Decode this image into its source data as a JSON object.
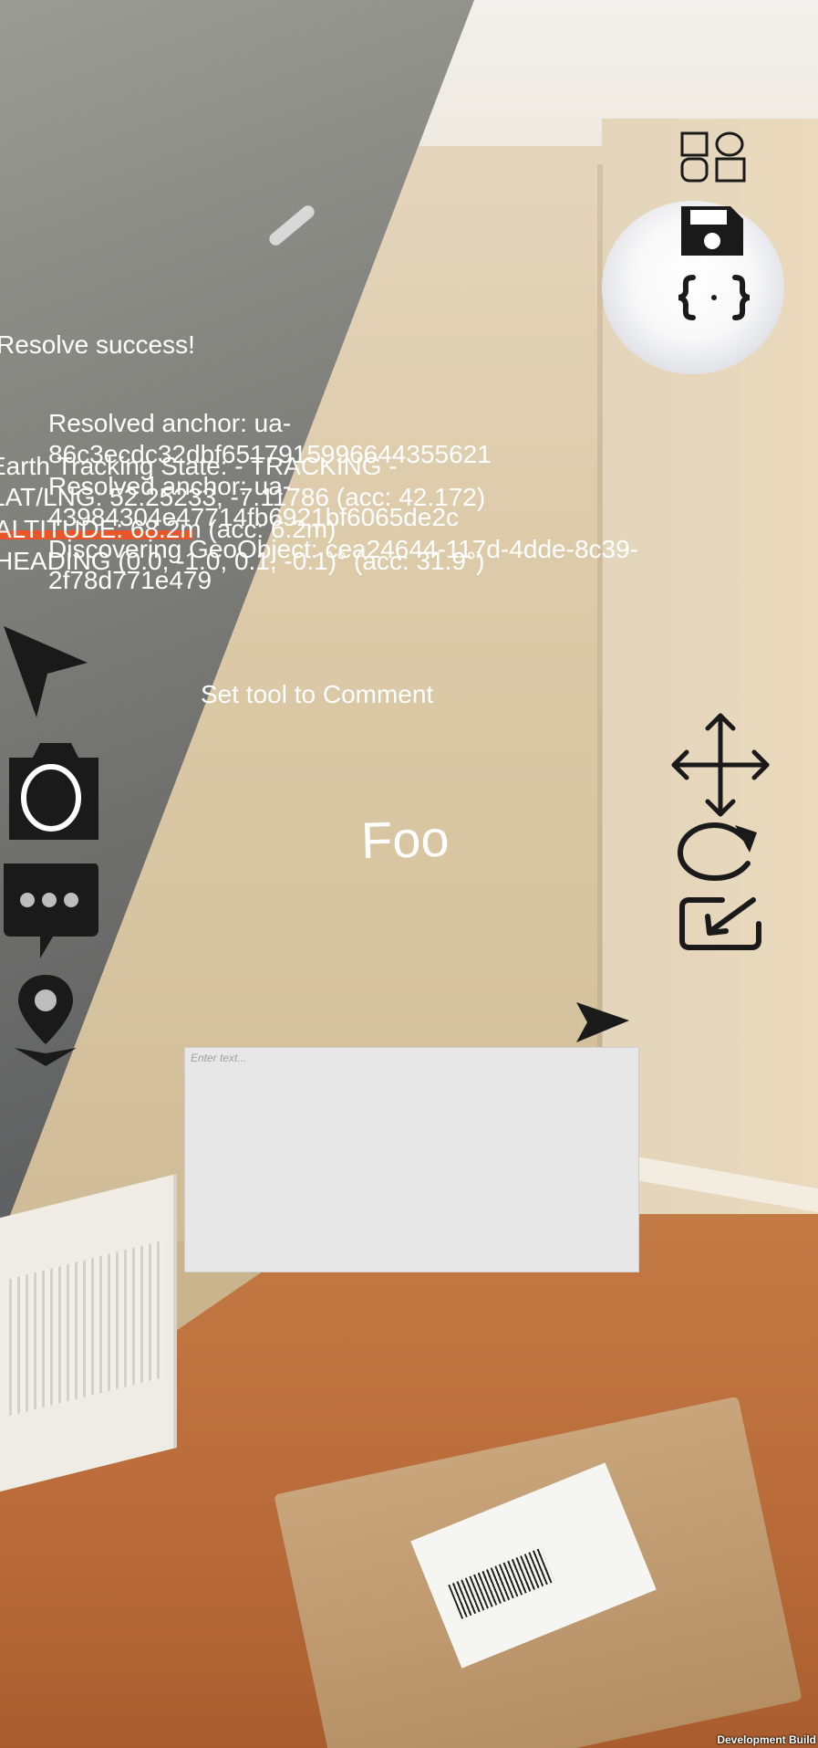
{
  "colors": {
    "accent": "#e8562a",
    "icon": "#1a1a1a",
    "text_overlay": "#ffffff",
    "input_bg": "#e8e7e8"
  },
  "status": {
    "resolve_success": "Resolve success!",
    "anchor_1_line1": "Resolved anchor: ua-",
    "anchor_1_line2": "86c3ecdc32dbf6517915996644355621",
    "anchor_2_line1": "Resolved anchor: ua-",
    "anchor_2_line2": "43984304e47714fb6921bf6065de2c",
    "discovering_line1": "Discovering GeoObject: cea24644-117d-4dde-8c39-",
    "discovering_line2": "2f78d771e479",
    "tracking_state": "Earth Tracking State:  - TRACKING -",
    "latlng": "LAT/LNG: 52.25233, -7.11786 (acc: 42.172)",
    "altitude": "ALTITUDE: 68.2m (acc: 6.2m)",
    "heading": "HEADING (0.0, -1.0, 0.1, -0.1)° (acc: 31.9°)"
  },
  "tool_message": "Set tool to Comment",
  "ar_label": "Foo",
  "comment_input": {
    "placeholder": "Enter text...",
    "value": ""
  },
  "footer": {
    "build_label": "Development Build"
  },
  "icons": {
    "top_right": [
      "shapes-icon",
      "save-icon",
      "json-braces-icon"
    ],
    "left_toolbar": [
      "pointer-arrow-icon",
      "camera-icon",
      "chat-bubble-icon",
      "drop-pin-icon"
    ],
    "right_toolbar": [
      "move-arrows-icon",
      "rotate-icon",
      "scale-icon"
    ],
    "send": "send-icon"
  }
}
